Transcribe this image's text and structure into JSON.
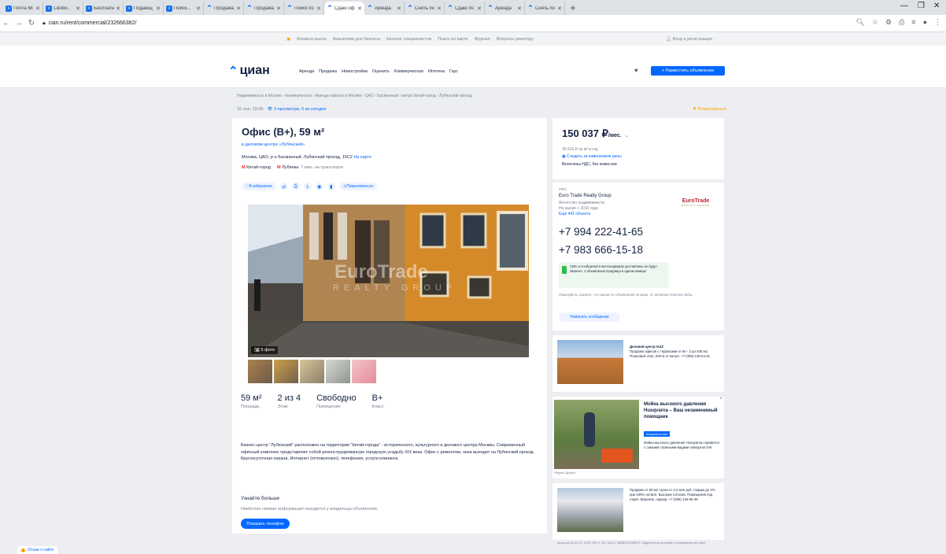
{
  "browser": {
    "tabs": [
      {
        "label": "Почта Mi",
        "icon": "mail-icon",
        "active": false
      },
      {
        "label": "Свобо..",
        "icon": "app-icon",
        "active": false
      },
      {
        "label": "Бесплатн",
        "icon": "app-icon",
        "active": false
      },
      {
        "label": "Подающ",
        "icon": "app-icon",
        "active": false
      },
      {
        "label": "Поиск...",
        "icon": "browser-icon",
        "active": false
      },
      {
        "label": "Продажа",
        "icon": "cian-icon",
        "active": false
      },
      {
        "label": "Продажа",
        "icon": "cian-icon",
        "active": false
      },
      {
        "label": "Поиск по",
        "icon": "cian-icon",
        "active": false
      },
      {
        "label": "Сдаю оф",
        "icon": "cian-icon",
        "active": true
      },
      {
        "label": "Аренда",
        "icon": "cian-icon",
        "active": false
      },
      {
        "label": "Снять по",
        "icon": "cian-icon",
        "active": false
      },
      {
        "label": "Сдаю по",
        "icon": "cian-icon",
        "active": false
      },
      {
        "label": "Аренда",
        "icon": "cian-icon",
        "active": false
      },
      {
        "label": "Снять по",
        "icon": "cian-icon",
        "active": false
      }
    ],
    "new_tab": "+",
    "url": "cian.ru/rent/commercial/232666382/"
  },
  "promo": {
    "items": [
      "Конкиса рынок",
      "Аналитика для бизнеса",
      "Каталог специалистов",
      "Поиск по карте",
      "Журнал",
      "Вопросы риэлтору"
    ],
    "login": "Вход и регистрация"
  },
  "header": {
    "logo": "циан",
    "nav": [
      "Аренда",
      "Продажа",
      "Новостройки",
      "Оценить",
      "Коммерческая",
      "Ипотека",
      "Гаус"
    ],
    "post_button": "+ Разместить объявление"
  },
  "breadcrumbs": "Недвижимость в Москве › Коммерческая › Аренда офисов в Москве › ЦАО › Басманный › метро Китай-город › Лубянский проезд",
  "meta": {
    "date": "16 ноя, 15:40",
    "views": "3 просмотра, 0 за сегодня"
  },
  "complain": "Пожаловаться",
  "listing": {
    "title": "Офис (B+), 59 м²",
    "business_center": "в деловом центре «Лубянский»",
    "address": "Москва, ЦАО, р-н Басманный, Лубянский проезд, 15С2",
    "address_map": "На карте",
    "metro": [
      {
        "name": "Китай-город",
        "note": ""
      },
      {
        "name": "Лубянка",
        "note": "7 мин. на транспорте"
      }
    ],
    "actions": {
      "favorite": "В избранное",
      "share": "Пожаловаться"
    },
    "watermark": "EuroTrade",
    "watermark_sub": "REALTY GROUP",
    "photo_count": "5 фото",
    "specs": [
      {
        "value": "59 м²",
        "label": "Площадь"
      },
      {
        "value": "2 из 4",
        "label": "Этаж"
      },
      {
        "value": "Свободно",
        "label": "Помещение"
      },
      {
        "value": "B+",
        "label": "Класс"
      }
    ],
    "description": "Бизнес-центр \"Лубянский\" расположен на территории \"Китай-города\" - исторического, культурного и делового центра Москвы. Современный офисный комплекс представляет собой реконструированную городскую усадьбу XIX века. Офис с ремонтом, окна выходят на Лубянский проезд. Круглосуточная охрана. Интернет (оптоволокно), телефония, услуги клининга.",
    "more_title": "Узнайте больше",
    "more_text": "Наиболее свежая информация находится у владельца объявления.",
    "show_phone": "Показать телефон"
  },
  "price": {
    "amount": "150 037 ₽",
    "unit": "/мес.",
    "per_year": "30 516 ₽ за м² в год",
    "track": "Следить за изменением цены",
    "vat": "Включены НДС, без комиссии"
  },
  "agent": {
    "tag": "PRO",
    "name": "Euro Trade Realty Group",
    "type": "Агентство недвижимости",
    "years": "На рынке с 2010 года",
    "objects": "Ещё 442 объекта",
    "logo": "EuroTrade",
    "logo_sub": "REALTY GROUP",
    "phones": [
      "+7 994 222-41-65",
      "+7 983 666-15-18"
    ],
    "sms": "СМС и сообщения в мессенджерах доставлены не будут. Звоните. 2 объявления продавца в одном номере",
    "note": "Пожалуйста, скажите, что нашли это объявление на Циан. Эт активная ответная связь.",
    "write": "Написать сообщение"
  },
  "ads": [
    {
      "title": "Деловой центр IAZZ",
      "text": "Продажа офисов с террасами от 60 - 2 до 400 м2. Плановый этап, 200 м от метро. +7 (495) 135-04-31"
    },
    {
      "title": "Мойка высокого давления Husqvarna – Ваш незаменимый помощник",
      "badge": "husqvarna.com",
      "text": "Мойка высокого давления Husqvarna справится с самыми сложными видами поверхностей",
      "source": "Яндекс.Директ"
    },
    {
      "title": "",
      "text": "Продажа от 60 м2. Цена от 3,2 млн руб. Скидка до 4% при 100% оплате. Высокие потолки. Помещения под отдел. Ведение, надзор. +7 (495) 126-55-48",
      "foot": "Акция до 30.04.20. ООО «КГУ». АО «АСС» ДЕВЕЛОПМЕНТ. Подробности условий и ограничения на сайте"
    }
  ],
  "feedback": "Отзыв о сайте"
}
